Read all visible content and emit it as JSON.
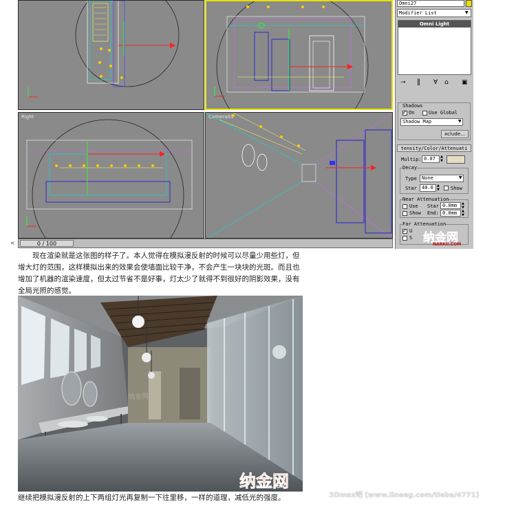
{
  "viewports": {
    "top_left": {
      "label": ""
    },
    "top_right": {
      "label": ""
    },
    "bottom_left": {
      "label": "Right"
    },
    "bottom_right": {
      "label": "Camera01"
    }
  },
  "timeline": {
    "frame_text": "0 / 100",
    "arrow": "<"
  },
  "panel": {
    "object_name": "Omni27",
    "modifier_list": "Modifier List",
    "stack_item": "Omni Light",
    "shadows": {
      "title": "Shadows",
      "on_label": "On",
      "on_checked": true,
      "use_global_label": "Use Global",
      "use_global_checked": false,
      "type": "Shadow Map",
      "exclude": "xclude..."
    },
    "intensity": {
      "title": "tensity/Color/Attenuati",
      "multiplier_label": "Multip:",
      "multiplier_value": "0.07",
      "color_swatch": "#e8dcc6"
    },
    "decay": {
      "title": "Decay",
      "type_label": "Type",
      "type_value": "None",
      "start_label": "Star",
      "start_value": "40.0",
      "show_label": "Show"
    },
    "near": {
      "title": "Near Attenuation",
      "use_label": "Use",
      "start_label": "Star",
      "start_value": "0.0mm",
      "show_label": "Show",
      "end_label": "End:",
      "end_value": "0.0mm"
    },
    "far": {
      "title": "Far Attenuation",
      "use_label": "U",
      "use_checked": true,
      "show_label": "S"
    }
  },
  "watermarks": {
    "panel_logo": "纳金网",
    "panel_logo_url": "NARKII.COM",
    "render_logo": "纳金网",
    "render_url": "NARKII.COM",
    "footer_url": "3Dmax吧 [www.lineeg.com/tieba/4771]"
  },
  "caption1": "现在渲染就是这张图的样子了。本人觉得在模拟漫反射的时候可以尽量少用些灯，但增大灯的范围，这样模拟出来的效果会使墙面比较干净，不会产生一块块的光斑。而且也增加了机器的渲染速度，但太过节省不是好事，灯太少了就得不到很好的阴影效果，没有全局光照的感觉。",
  "caption2": "继续把模拟漫反射的上下两组灯光再复制一下往里移，一样的道理，减低光的强度。",
  "colors": {
    "active_border": "#e8e000",
    "panel_bg": "#c4c4c4",
    "viewport_bg": "#8a8a8a"
  }
}
